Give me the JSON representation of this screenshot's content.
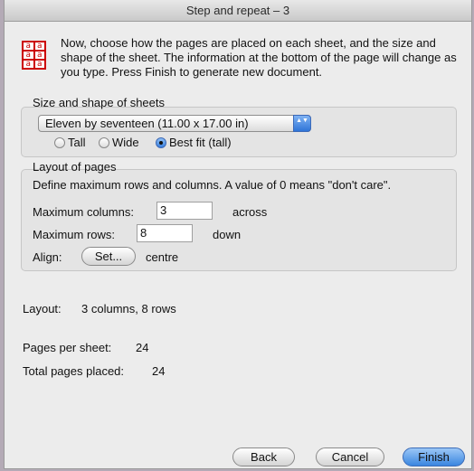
{
  "window": {
    "title": "Step and repeat – 3"
  },
  "intro": {
    "icon_glyph": "a",
    "text": "Now, choose how the pages are placed on each sheet, and the size and shape of the sheet. The information at the bottom of the page will change as you type. Press Finish to generate new document."
  },
  "size_group": {
    "title": "Size and shape of sheets",
    "paper": {
      "selected": "Eleven by seventeen (11.00 x 17.00 in)",
      "arrows": "▲▼"
    },
    "orientation": [
      {
        "label": "Tall",
        "selected": false
      },
      {
        "label": "Wide",
        "selected": false
      },
      {
        "label": "Best fit (tall)",
        "selected": true
      }
    ]
  },
  "layout_group": {
    "title": "Layout of pages",
    "description": "Define maximum rows and columns. A value of 0 means \"don't care\".",
    "max_columns_label": "Maximum columns:",
    "max_columns_value": "3",
    "max_columns_suffix": "across",
    "max_rows_label": "Maximum rows:",
    "max_rows_value": "8",
    "max_rows_suffix": "down",
    "align_label": "Align:",
    "set_button": "Set...",
    "align_value": "centre"
  },
  "summary": {
    "layout_label": "Layout:",
    "layout_value": "3 columns, 8 rows",
    "pages_per_sheet_label": "Pages per sheet:",
    "pages_per_sheet_value": "24",
    "total_placed_label": "Total pages placed:",
    "total_placed_value": "24"
  },
  "buttons": {
    "back": "Back",
    "cancel": "Cancel",
    "finish": "Finish"
  },
  "colors": {
    "accent": "#3a86e0",
    "icon_red": "#cc0000"
  }
}
